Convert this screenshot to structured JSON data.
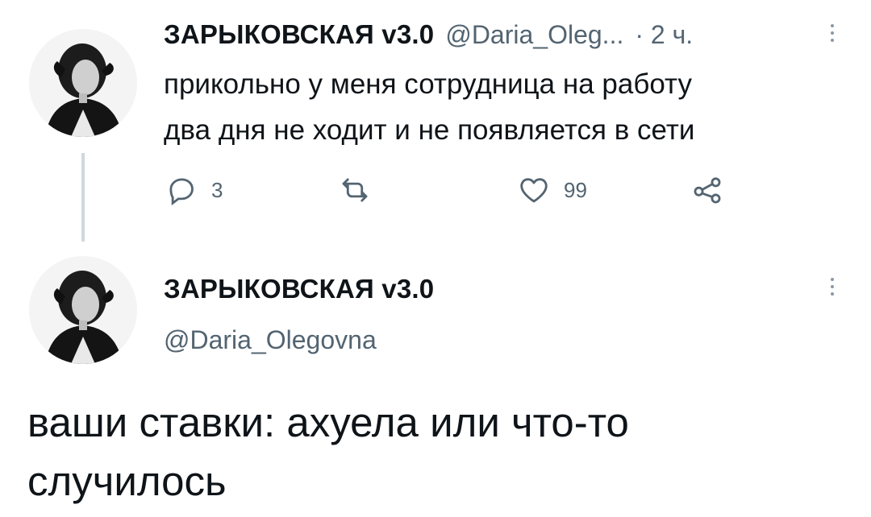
{
  "tweet1": {
    "display_name": "ЗАРЫКОВСКАЯ v3.0",
    "handle": "@Daria_Oleg...",
    "time": "· 2 ч.",
    "text_line1": "прикольно у меня сотрудница на работу",
    "text_line2": "два дня не ходит и не появляется в сети",
    "reply_count": "3",
    "like_count": "99"
  },
  "tweet2": {
    "display_name": "ЗАРЫКОВСКАЯ v3.0",
    "handle": "@Daria_Olegovna",
    "text_line1": "ваши ставки: ахуела или что-то",
    "text_line2": "случилось"
  },
  "icons": {
    "reply": "reply-icon",
    "retweet": "retweet-icon",
    "like": "heart-icon",
    "share": "share-icon",
    "more": "more-options-icon"
  },
  "colors": {
    "secondary_text": "#536471",
    "thread_line": "#cfd9de"
  }
}
